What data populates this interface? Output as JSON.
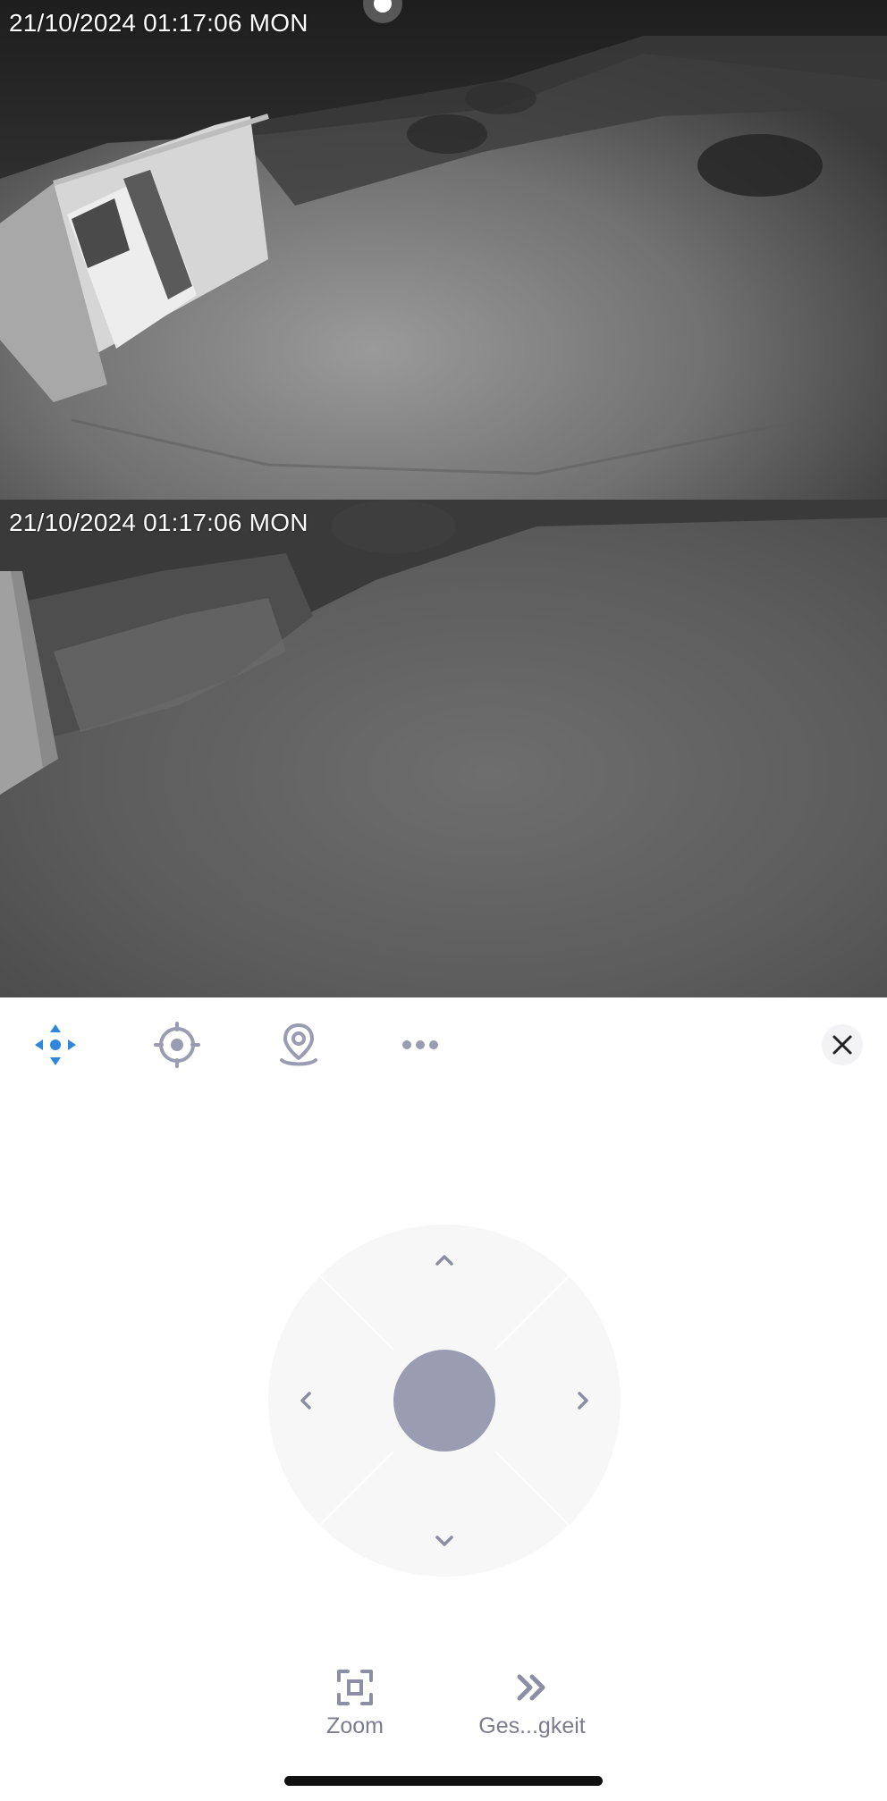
{
  "camera_views": [
    {
      "timestamp": "21/10/2024 01:17:06 MON"
    },
    {
      "timestamp": "21/10/2024 01:17:06 MON"
    }
  ],
  "toolbar": {
    "tools": [
      {
        "icon": "pan-tilt-icon",
        "state": "active"
      },
      {
        "icon": "crosshair-icon",
        "state": "inactive"
      },
      {
        "icon": "camera-location-icon",
        "state": "inactive"
      },
      {
        "icon": "more-icon",
        "state": "inactive"
      }
    ],
    "close_icon": "close-icon"
  },
  "joystick": {
    "directions": [
      "up",
      "right",
      "down",
      "left"
    ]
  },
  "bottom_tools": {
    "zoom_label": "Zoom",
    "speed_label": "Ges...gkeit"
  },
  "colors": {
    "accent": "#2f86dc",
    "icon_gray": "#9a9cb1",
    "label_gray": "#7b7d8f",
    "joystick_bg": "#f7f7f8",
    "joystick_knob": "#9a9cb1"
  }
}
